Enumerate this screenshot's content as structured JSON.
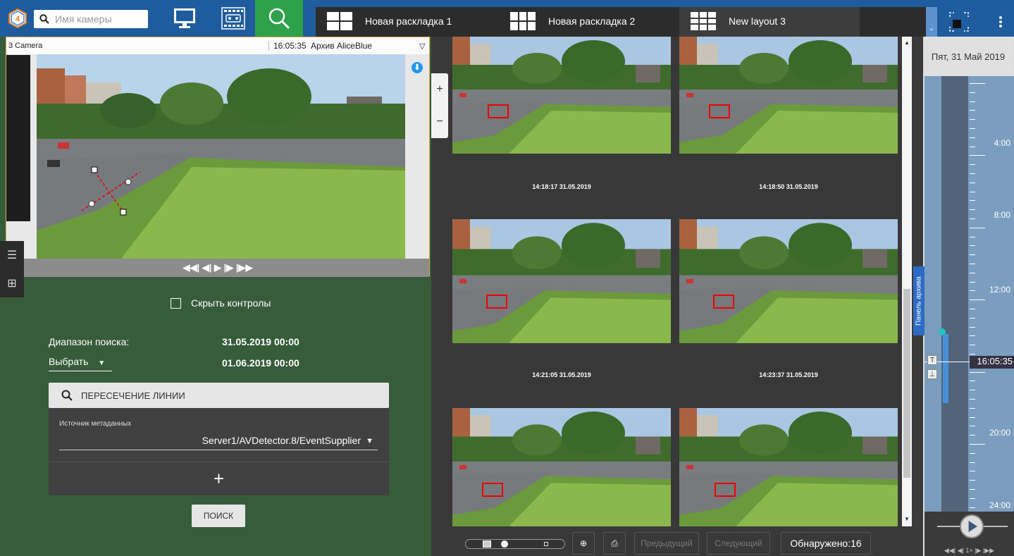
{
  "toolbar": {
    "search_placeholder": "Имя камеры",
    "layouts": [
      {
        "label": "Новая раскладка 1"
      },
      {
        "label": "Новая раскладка 2"
      },
      {
        "label": "New layout 3"
      }
    ]
  },
  "camera": {
    "title": "3 Camera",
    "time": "16:05:35",
    "archive": "Архив AliceBlue",
    "controls": "◀◀| ◀| ▶ |▶ |▶▶"
  },
  "search_panel": {
    "hide_controls": "Скрыть контролы",
    "range_label": "Диапазон поиска:",
    "range_from": "31.05.2019 00:00",
    "choose": "Выбрать",
    "range_to": "01.06.2019 00:00",
    "line_crossing": "ПЕРЕСЕЧЕНИЕ ЛИНИИ",
    "metadata_label": "Источник метаданных",
    "metadata_value": "Server1/AVDetector.8/EventSupplier",
    "add": "+",
    "find": "ПОИСК"
  },
  "results": {
    "timestamps": [
      "14:18:17 31.05.2019",
      "14:18:50 31.05.2019",
      "14:21:05 31.05.2019",
      "14:23:37 31.05.2019"
    ],
    "prev": "Предыдущий",
    "next": "Следующий",
    "found": "Обнаружено:16"
  },
  "archive": {
    "date": "Пят, 31 Май 2019",
    "tab": "Панель архива",
    "times": [
      "4:00",
      "8:00",
      "12:00",
      "20:00",
      "24:00"
    ],
    "current": "16:05:35",
    "controls": "◀◀| ◀| 1× |▶ |▶▶"
  },
  "colors": {
    "brand": "#1f5c9e",
    "search_green": "#2ea14a",
    "panel_green": "#365c3a",
    "archive_blue": "#2d6bc4"
  }
}
